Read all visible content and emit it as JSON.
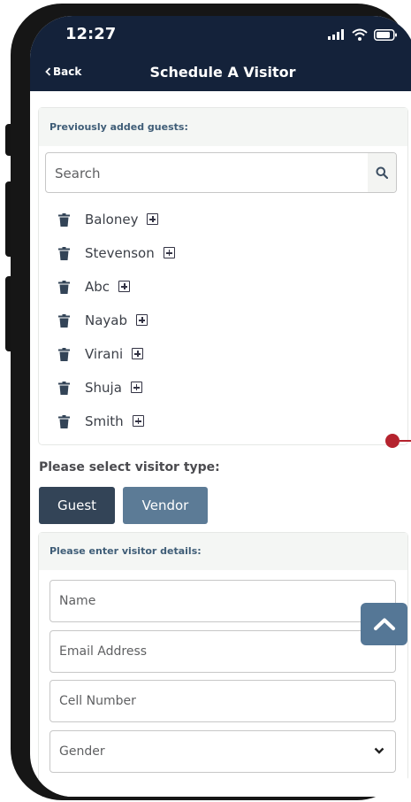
{
  "status_bar": {
    "time": "12:27",
    "icons": [
      "cellular-icon",
      "wifi-icon",
      "battery-icon"
    ]
  },
  "header": {
    "back_label": "Back",
    "title": "Schedule A Visitor"
  },
  "guests": {
    "heading": "Previously added guests:",
    "search_placeholder": "Search",
    "items": [
      {
        "name": "Baloney"
      },
      {
        "name": "Stevenson"
      },
      {
        "name": "Abc"
      },
      {
        "name": "Nayab"
      },
      {
        "name": "Virani"
      },
      {
        "name": "Shuja"
      },
      {
        "name": "Smith"
      }
    ]
  },
  "visitor_type": {
    "label": "Please select visitor type:",
    "options": [
      "Guest",
      "Vendor"
    ],
    "selected": "Guest"
  },
  "details": {
    "heading": "Please enter visitor details:",
    "name_placeholder": "Name",
    "email_placeholder": "Email Address",
    "cell_placeholder": "Cell Number",
    "gender_placeholder": "Gender"
  },
  "colors": {
    "header": "#14223a",
    "selected_button": "#334457",
    "unselected_button": "#5c7b96",
    "section_heading": "#3f5d77"
  }
}
